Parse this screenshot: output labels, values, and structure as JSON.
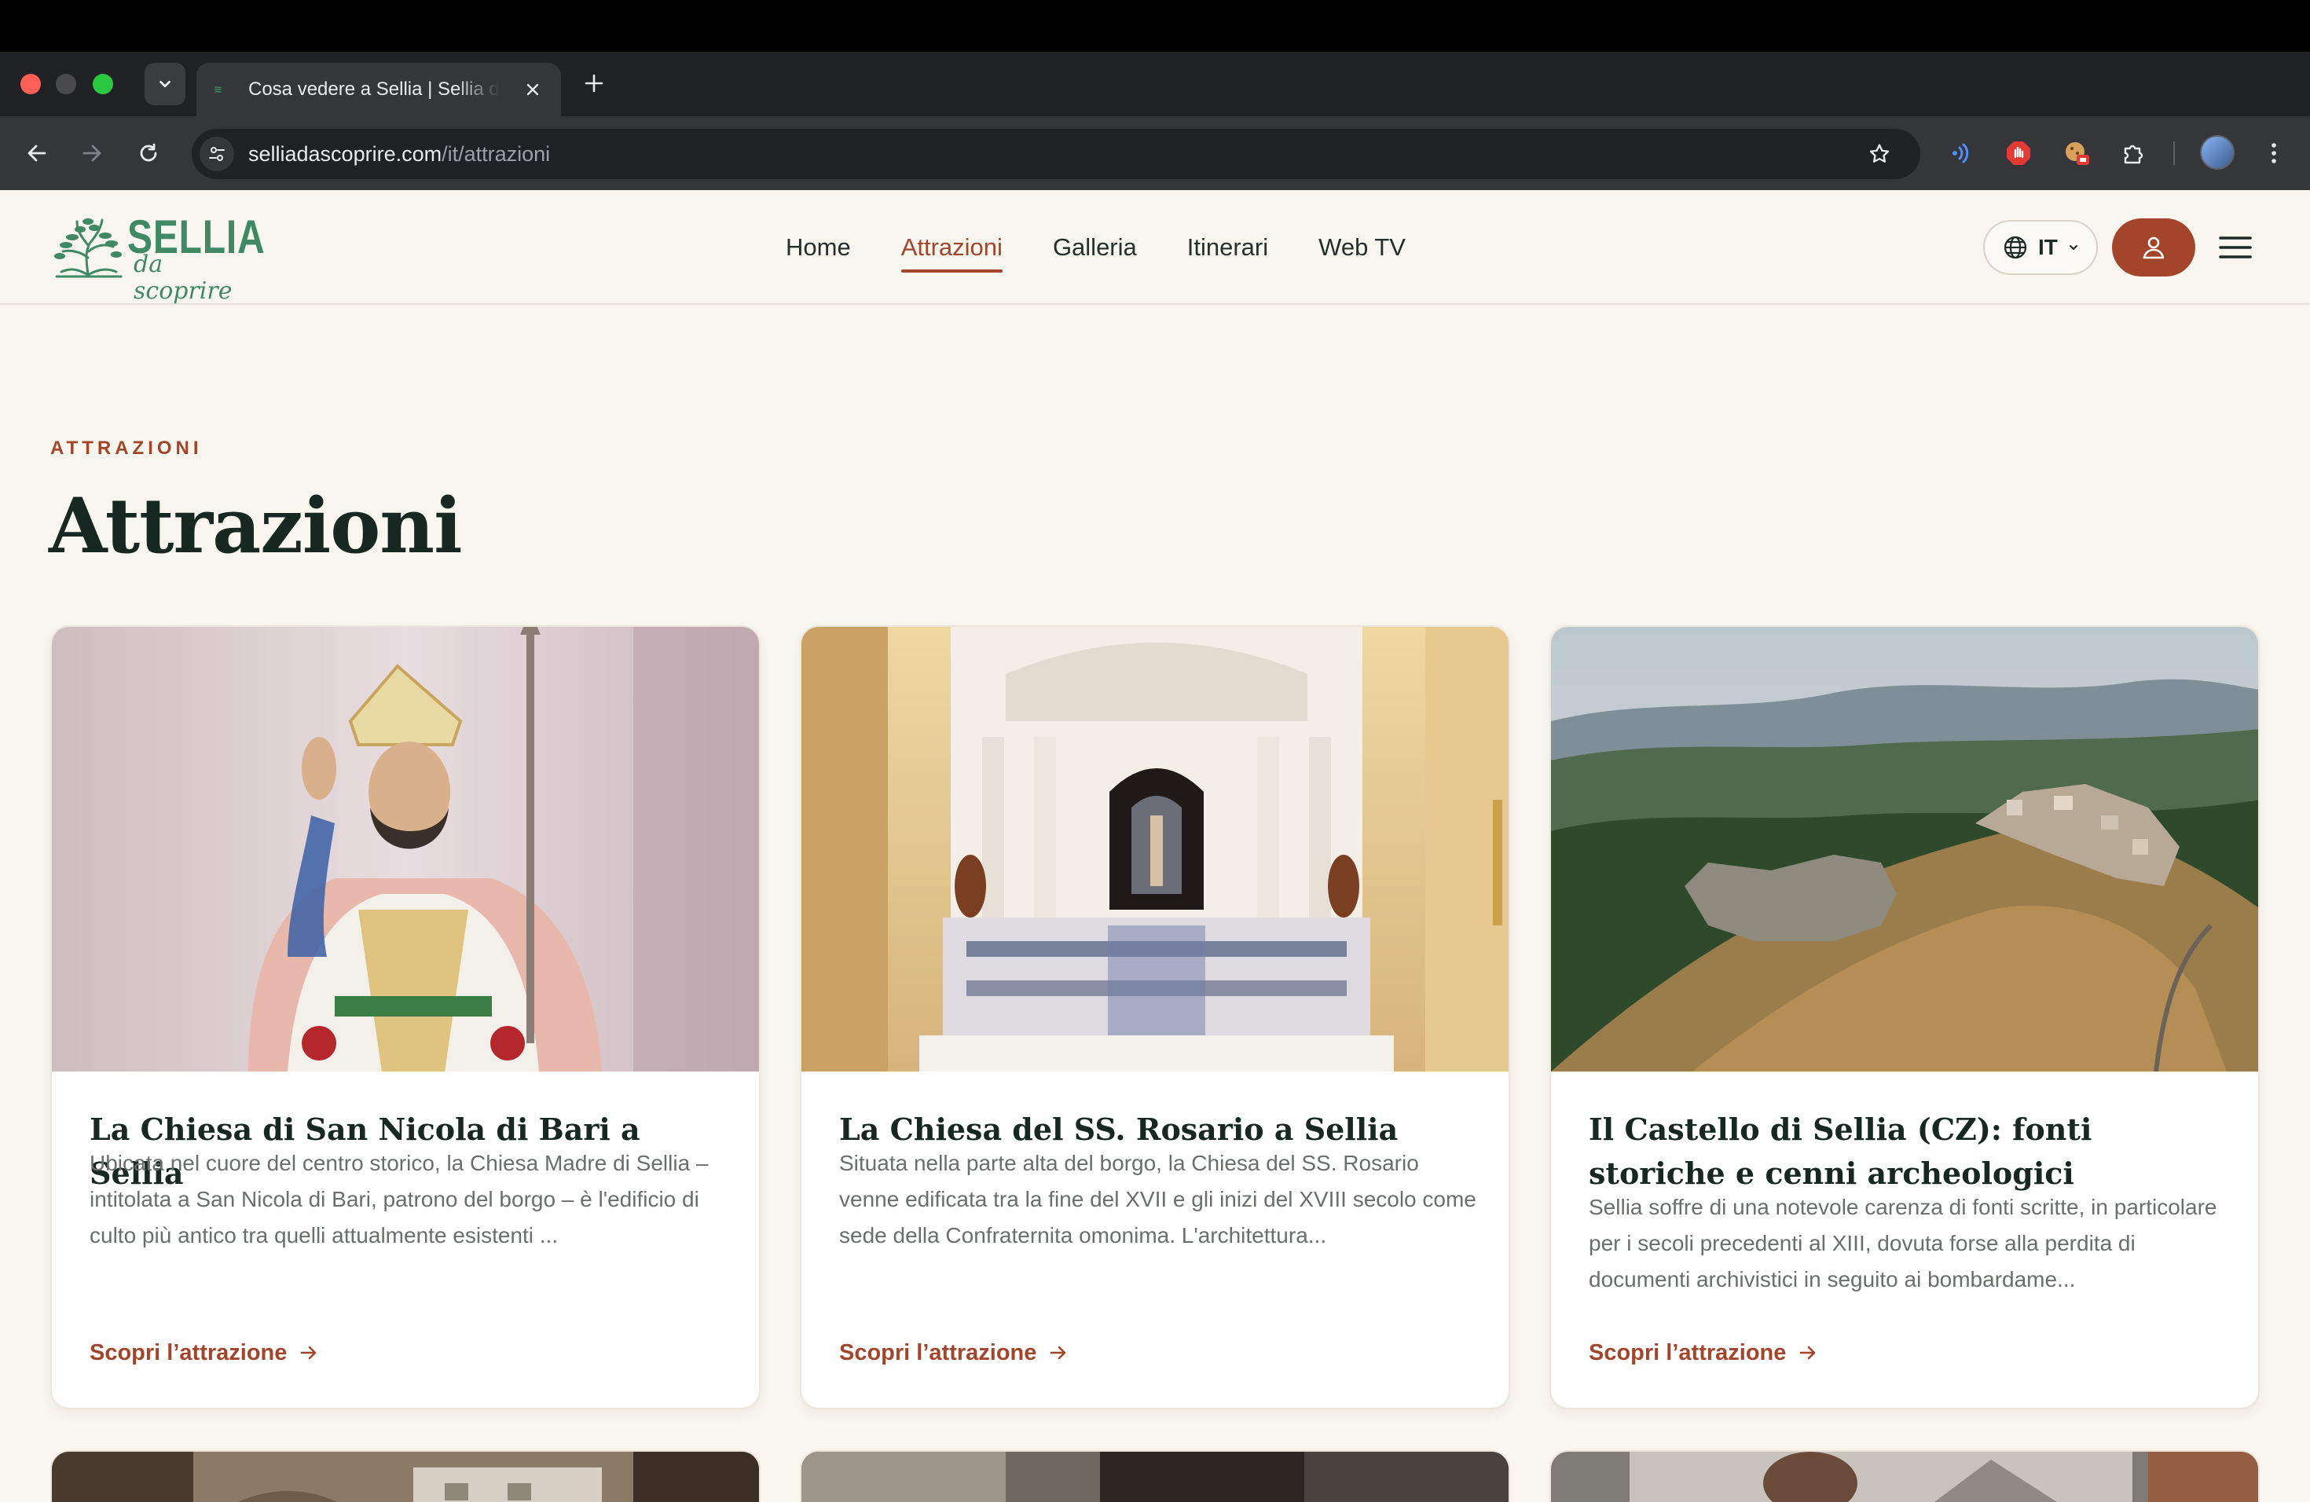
{
  "browser": {
    "tab_title": "Cosa vedere a Sellia | Sellia da scoprire",
    "url_host": "selliadascoprire.com",
    "url_path": "/it/attrazioni"
  },
  "site": {
    "logo_title": "SELLIA",
    "logo_subtitle": "da scoprire",
    "nav": [
      {
        "label": "Home"
      },
      {
        "label": "Attrazioni"
      },
      {
        "label": "Galleria"
      },
      {
        "label": "Itinerari"
      },
      {
        "label": "Web TV"
      }
    ],
    "language": "IT"
  },
  "page": {
    "eyebrow": "ATTRAZIONI",
    "title": "Attrazioni"
  },
  "cards": [
    {
      "title": "La Chiesa di San Nicola di Bari a Sellia",
      "description": "Ubicata nel cuore del centro storico, la Chiesa Madre di Sellia – intitolata a San Nicola di Bari, patrono del borgo – è l'edificio di culto più antico tra quelli attualmente esistenti ...",
      "cta": "Scopri l’attrazione"
    },
    {
      "title": "La Chiesa del SS. Rosario a Sellia",
      "description": "Situata nella parte alta del borgo, la Chiesa del SS. Rosario venne edificata tra la fine del XVII e gli inizi del XVIII secolo come sede della Confraternita omonima. L'architettura...",
      "cta": "Scopri l’attrazione"
    },
    {
      "title": "Il Castello di Sellia (CZ): fonti storiche e cenni archeologici",
      "description": "Sellia soffre di una notevole carenza di fonti scritte, in particolare per i secoli precedenti al XIII, dovuta forse alla perdita di documenti archivistici in seguito ai bombardame...",
      "cta": "Scopri l’attrazione"
    }
  ],
  "colors": {
    "accent": "#a3452a",
    "brand_green": "#3f8a63",
    "background": "#f9f6f0",
    "heading": "#172722"
  }
}
